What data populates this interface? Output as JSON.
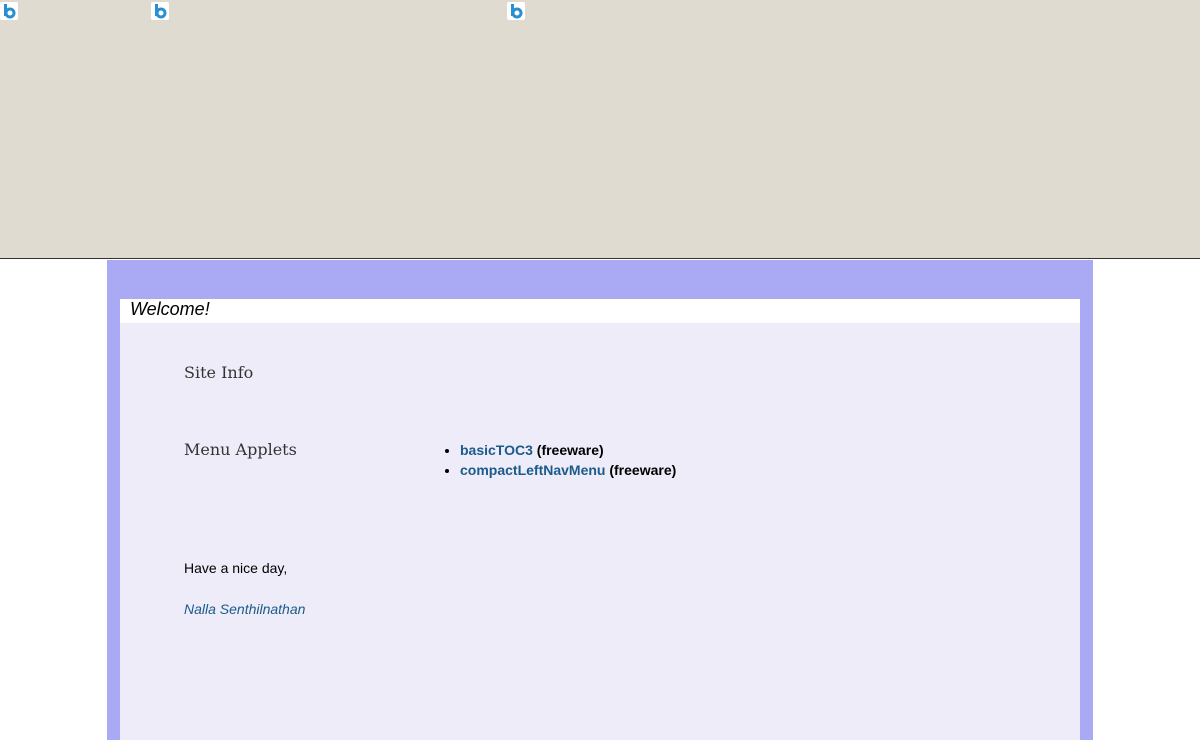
{
  "banner": {
    "background": "#dfdbd0",
    "badges": [
      "bing-icon",
      "bing-icon",
      "bing-icon"
    ],
    "badge_color": "#2a8fd1"
  },
  "main": {
    "welcome": "Welcome!",
    "site_info_heading": "Site Info",
    "menu_applets_heading": "Menu Applets",
    "applets": [
      {
        "name": "basicTOC3",
        "note": "(freeware)"
      },
      {
        "name": "compactLeftNavMenu",
        "note": "(freeware)"
      }
    ],
    "closing": "Have a nice day,",
    "signature": "Nalla Senthilnathan"
  },
  "colors": {
    "frame": "#aaaaf4",
    "panel": "#edecf8",
    "link": "#1b5a8a"
  }
}
